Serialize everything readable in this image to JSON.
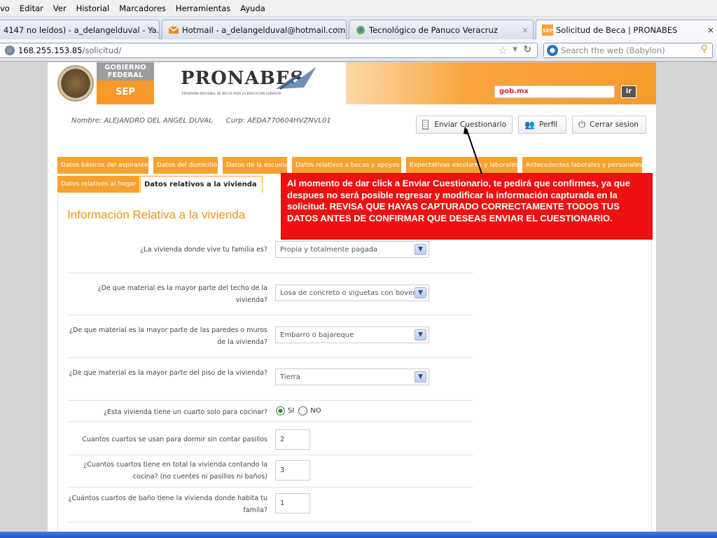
{
  "menu": [
    "vo",
    "Editar",
    "Ver",
    "Historial",
    "Marcadores",
    "Herramientas",
    "Ayuda"
  ],
  "tabs": [
    {
      "label": "4147 no leídos) - a_delangelduval - Ya...",
      "close": "×"
    },
    {
      "label": "Hotmail - a_delangelduval@hotmail.com",
      "close": "×"
    },
    {
      "label": "Tecnológico de Panuco Veracruz",
      "close": "×"
    },
    {
      "label": "Solicitud de Beca | PRONABES",
      "close": "×"
    }
  ],
  "address": {
    "host": "168.255.153.85",
    "path": "/solicitud/"
  },
  "browser_search": {
    "placeholder": "Search the web (Babylon)"
  },
  "header": {
    "gob_line1": "GOBIERNO",
    "gob_line2": "FEDERAL",
    "sep": "SEP",
    "brand": "PRONABES",
    "brand_sub": "PROGRAMA NACIONAL DE BECAS PARA LA EDUCACIÓN SUPERIOR",
    "search_logo": "gob.mx",
    "search_button": "ir"
  },
  "user": {
    "nombre_label": "Nombre:",
    "nombre": "ALEJANDRO DEL ANGEL DUVAL",
    "curp_label": "Curp:",
    "curp": "AEDA770604HVZNVL01"
  },
  "actions": {
    "enviar": "Enviar Cuestionario",
    "perfil": "Perfil",
    "cerrar": "Cerrar sesion"
  },
  "form_tabs_row1": [
    "Datos básicos del aspirante",
    "Datos del domicilio",
    "Datos de la escuela",
    "Datos relativos a becas y apoyos",
    "Expectativas escolares y laborales",
    "Antecedentes laborales y personales"
  ],
  "form_tabs_row2": [
    "Datos relativos al hogar",
    "Datos relativos a la vivienda"
  ],
  "section_title": "Información Relativa a la vivienda",
  "questions": [
    {
      "label": "¿La vivienda donde vive tu familia es?",
      "value": "Propia y totalmente pagada"
    },
    {
      "label": "¿De que material es la mayor parte del techo de la vivienda?",
      "value": "Losa de concreto o viguetas con bovedilla"
    },
    {
      "label": "¿De que material es la mayor parte de las paredes o muros de la vivienda?",
      "value": "Embarro o bajareque"
    },
    {
      "label": "¿De que material es la mayor parte del piso de la vivienda?",
      "value": "Tierra"
    }
  ],
  "cocina": {
    "label": "¿Esta vivienda tiene un cuarto solo para cocinar?",
    "si": "SI",
    "no": "NO",
    "selected": "SI"
  },
  "numeric_questions": [
    {
      "label": "Cuantos cuartos se usan para dormir sin contar pasillos",
      "value": "2"
    },
    {
      "label": "¿Cuantos cuartos tiene en total la vivienda contando la cocina? (no cuentes ni pasillos ni baños)",
      "value": "3"
    },
    {
      "label": "¿Cuántos cuartos de baño tiene la vivienda donde habita tu famila?",
      "value": "1"
    }
  ],
  "callout": "Al momento de dar click a Enviar Cuestionario, te pedirá que confirmes, ya que despues no será posible regresar y modificar la información capturada en la solicitud. REVISA QUE HAYAS CAPTURADO CORRECTAMENTE TODOS TUS DATOS ANTES DE CONFIRMAR QUE DESEAS ENVIAR EL CUESTIONARIO.",
  "colors": {
    "accent": "#f7a12f",
    "callout": "#ee1111"
  }
}
